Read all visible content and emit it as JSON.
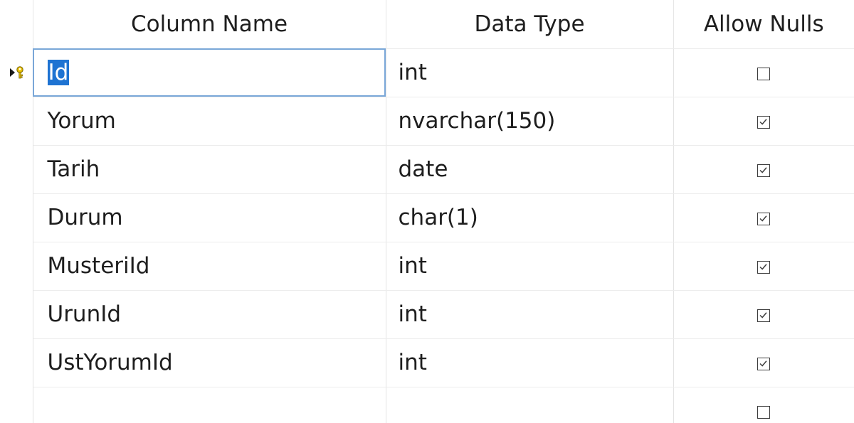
{
  "headers": {
    "column_name": "Column Name",
    "data_type": "Data Type",
    "allow_nulls": "Allow Nulls"
  },
  "rows": [
    {
      "name": "Id",
      "type": "int",
      "allow_nulls": false,
      "primary_key": true,
      "current": true
    },
    {
      "name": "Yorum",
      "type": "nvarchar(150)",
      "allow_nulls": true
    },
    {
      "name": "Tarih",
      "type": "date",
      "allow_nulls": true
    },
    {
      "name": "Durum",
      "type": "char(1)",
      "allow_nulls": true
    },
    {
      "name": "MusteriId",
      "type": "int",
      "allow_nulls": true
    },
    {
      "name": "UrunId",
      "type": "int",
      "allow_nulls": true
    },
    {
      "name": "UstYorumId",
      "type": "int",
      "allow_nulls": true
    },
    {
      "name": "",
      "type": "",
      "allow_nulls": false
    }
  ],
  "icons": {
    "current_row": "current-row-arrow-icon",
    "primary_key": "primary-key-icon"
  },
  "colors": {
    "selection": "#1e73d2",
    "key_gold": "#e8c000",
    "edit_border": "#7aa7d8"
  }
}
